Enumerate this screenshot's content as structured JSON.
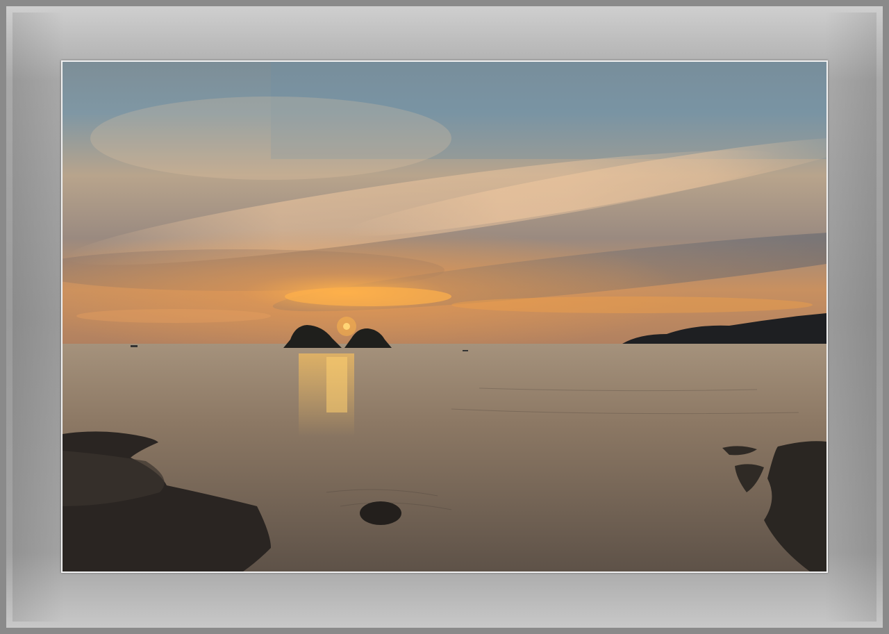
{
  "scene": {
    "subject": "sunset-over-sea",
    "colors": {
      "sky_top": "#5f7f93",
      "sky_mid": "#c8a07a",
      "sky_glow": "#f0a24a",
      "sun": "#ffd25a",
      "water": "#8a7560",
      "rock": "#2b2622",
      "frame": "#9b9b9b",
      "mat_border": "#f2f2f2"
    }
  }
}
